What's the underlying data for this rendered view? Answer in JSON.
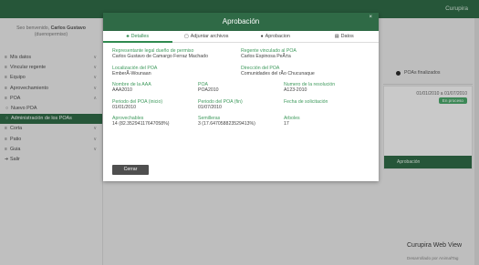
{
  "topbar": {
    "brand": "Curupira"
  },
  "sidebar": {
    "welcome_prefix": "Seo benvenido,",
    "user_name": "Carlos Gustavo",
    "user_handle": "(duenopermiso)",
    "items": [
      {
        "label": "Mis datos",
        "icon": "list-icon",
        "glyph": "≡",
        "chevron": "∨"
      },
      {
        "label": "Vincular regente",
        "icon": "list-icon",
        "glyph": "≡",
        "chevron": "∨"
      },
      {
        "label": "Equipo",
        "icon": "list-icon",
        "glyph": "≡",
        "chevron": "∨"
      },
      {
        "label": "Aprovechamiento",
        "icon": "list-icon",
        "glyph": "≡",
        "chevron": "∨"
      },
      {
        "label": "POA",
        "icon": "list-icon",
        "glyph": "≡",
        "chevron": "∧"
      },
      {
        "label": "Nuevo POA",
        "icon": "circle-icon",
        "glyph": "○",
        "chevron": ""
      },
      {
        "label": "Administración de los POAs",
        "icon": "circle-icon",
        "glyph": "○",
        "chevron": ""
      },
      {
        "label": "Corta",
        "icon": "list-icon",
        "glyph": "≡",
        "chevron": "∨"
      },
      {
        "label": "Patio",
        "icon": "list-icon",
        "glyph": "≡",
        "chevron": "∨"
      },
      {
        "label": "Guia",
        "icon": "list-icon",
        "glyph": "≡",
        "chevron": "∨"
      },
      {
        "label": "Salir",
        "icon": "logout-icon",
        "glyph": "➔",
        "chevron": ""
      }
    ]
  },
  "background": {
    "legend_label": "POAs finalizados",
    "card_dates": "01/01/2010 a 01/07/2010",
    "card_pill": "En proceso",
    "card_footer": "Aprobación",
    "app_name": "Curupira Web View",
    "credit": "Desarrollado por AnimalTag"
  },
  "modal": {
    "title": "Aprobación",
    "close_glyph": "×",
    "tabs": [
      {
        "label": "Detalles",
        "icon": "tree-icon",
        "glyph": "♣",
        "active": true
      },
      {
        "label": "Adjuntar archivos",
        "icon": "file-icon",
        "glyph": "▢",
        "active": false
      },
      {
        "label": "Aprobacion",
        "icon": "check-circle-icon",
        "glyph": "●",
        "active": false
      },
      {
        "label": "Datos",
        "icon": "table-icon",
        "glyph": "▤",
        "active": false
      }
    ],
    "fields": {
      "rep_label": "Representante legal dueño de permiso",
      "rep_value": "Carlos Gustavo de Camargo Ferraz Machado",
      "regente_label": "Regente vinculado al POA",
      "regente_value": "Carlos Espinosa PeÃ±a",
      "loc_label": "Localización del POA",
      "loc_value": "EmberÃ-Wounaan",
      "dir_label": "Dirección del POA",
      "dir_value": "Comunidades del rÃo Chucunaque",
      "aaa_label": "Nombre de la AAA",
      "aaa_value": "AAA2010",
      "poa_label": "POA",
      "poa_value": "POA2010",
      "res_label": "Numero de la resolución",
      "res_value": "A123-2010",
      "ini_label": "Periodo del POA (inicio)",
      "ini_value": "01/01/2010",
      "fin_label": "Periodo del POA (fin)",
      "fin_value": "01/07/2010",
      "sol_label": "Fecha de solicitación",
      "sol_value": "",
      "apr_label": "Aprovechables",
      "apr_value": "14 (82.35294117647058%)",
      "sem_label": "Semilleras",
      "sem_value": "3 (17.647058823529413%)",
      "arb_label": "Arboles",
      "arb_value": "17"
    },
    "close_button": "Cerrar"
  }
}
